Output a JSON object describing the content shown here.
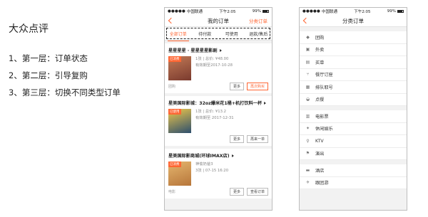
{
  "notes": {
    "title": "大众点评",
    "points": [
      "1、第一层：订单状态",
      "2、第二层：引导复购",
      "3、第三层：切换不同类型订单"
    ]
  },
  "status_bar": {
    "carrier": "中国联通",
    "time": "下午2:05",
    "battery": "99%"
  },
  "orders": {
    "title": "我的订单",
    "right_link": "分类订单",
    "tabs": [
      "全部订单",
      "待付款",
      "可使用",
      "退款/售后"
    ],
    "cards": [
      {
        "title": "星星星星 · 星星星星影剧",
        "badge": "已消费",
        "count": "1张",
        "price": "总价: ¥48.00",
        "valid": "有效期至2017-10-28",
        "category": "团购",
        "buttons": [
          "更多",
          "再次购买"
        ]
      },
      {
        "title": "星美国际影城：32oz爆米花1桶+机打饮料一杯",
        "badge": "已使用",
        "count": "1张",
        "price": "总价: ¥13.2",
        "valid": "有效期至 2017-12-31",
        "category": "",
        "buttons": [
          "更多",
          "再来一单"
        ]
      },
      {
        "title": "星美国际影商城(环球IMAX店)",
        "badge": "已消费",
        "movie": "神偷奶爸3",
        "seat": "3张 | 07-15 16:20",
        "category": "电影",
        "buttons": [
          "更多",
          "查看订单"
        ]
      }
    ]
  },
  "categories": {
    "title": "分类订单",
    "sections": [
      [
        {
          "icon": "tag",
          "label": "团购"
        },
        {
          "icon": "bag",
          "label": "外卖"
        },
        {
          "icon": "card",
          "label": "买单"
        },
        {
          "icon": "fork",
          "label": "餐厅订座"
        },
        {
          "icon": "ticket",
          "label": "排队取号"
        },
        {
          "icon": "spoon",
          "label": "点餐"
        }
      ],
      [
        {
          "icon": "film",
          "label": "电影票"
        },
        {
          "icon": "sun",
          "label": "休闲娱乐"
        },
        {
          "icon": "mic",
          "label": "KTV"
        },
        {
          "icon": "flag",
          "label": "演出"
        }
      ],
      [
        {
          "icon": "bed",
          "label": "酒店"
        },
        {
          "icon": "flight",
          "label": "跟团游"
        }
      ]
    ]
  }
}
